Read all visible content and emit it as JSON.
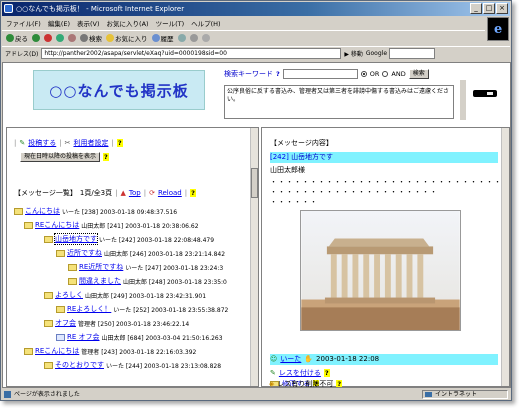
{
  "window": {
    "title": "○○なんでも掲示板！ - Microsoft Internet Explorer",
    "controls": [
      "_",
      "□",
      "×"
    ]
  },
  "menu": [
    "ファイル(F)",
    "編集(E)",
    "表示(V)",
    "お気に入り(A)",
    "ツール(T)",
    "ヘルプ(H)"
  ],
  "toolbar": {
    "back": "戻る",
    "search": "検索",
    "favorites": "お気に入り",
    "history": "履歴"
  },
  "address": {
    "label": "アドレス(D)",
    "url": "http://panther2002/asapa/servlet/eXaq?uid=0000198sid=00",
    "go": "移動",
    "google_label": "Google"
  },
  "board": {
    "title": "○○なんでも掲示板"
  },
  "search": {
    "label": "検索キーワード",
    "or_label": "OR",
    "and_label": "AND",
    "button": "検索"
  },
  "notice": "公序良俗に反する書込み、管理者又は第三者を誹謗中傷する書込みはご遠慮ください。",
  "left": {
    "post_link": "投稿する",
    "terms_link": "利用者設定",
    "recent_button": "現在日時以降の投稿を表示",
    "list_title": "【メッセージ一覧】",
    "page_info": "1頁/全3頁",
    "top_link": "Top",
    "reload_link": "Reload",
    "help": "?",
    "threads": [
      {
        "title": "こんにちは",
        "meta": "いーた [238] 2003-01-18 09:48:37.516"
      },
      {
        "title": "REこんにちは",
        "meta": "山田太郎 [241] 2003-01-18 20:38:06.62"
      },
      {
        "title": "山岳地方です",
        "meta": "いーた [242] 2003-01-18 22:08:48.479"
      },
      {
        "title": "近所ですね",
        "meta": "山田太郎 [246] 2003-01-18 23:21:14.842"
      },
      {
        "title": "RE近所ですね",
        "meta": "いーた [247] 2003-01-18 23:24:3"
      },
      {
        "title": "間違えました",
        "meta": "山田太郎 [248] 2003-01-18 23:35:0"
      },
      {
        "title": "よろしく",
        "meta": "山田太郎 [249] 2003-01-18 23:42:31.901"
      },
      {
        "title": "REよろしく！",
        "meta": "いーた [252] 2003-01-18 23:55:38.872"
      },
      {
        "title": "オフ会",
        "meta": "管理者 [250] 2003-01-18 23:46:22.14"
      },
      {
        "title": "RE オフ会",
        "meta": "山田太郎 [684] 2003-03-04 21:50:16.263"
      },
      {
        "title": "REこんにちは",
        "meta": "管理者 [243] 2003-01-18 22:16:03.392"
      },
      {
        "title": "そのとおりです",
        "meta": "いーた [244] 2003-01-18 23:13:08.828"
      }
    ]
  },
  "right": {
    "heading": "【メッセージ内容】",
    "msg_number": "[242]",
    "msg_title": "山岳地方です",
    "recipient": "山田太郎様",
    "body_lines": [
      "・・・・・・・・・・・・・・・・・・・・・・・・・・・・・・・・・・",
      "・・・・・・・・・・・・・・・・・・・・・",
      "・・・・・・"
    ],
    "author": "いーた",
    "datetime": "2003-01-18 22:08",
    "reply_link": "レスを付ける",
    "edit_link": "修正する",
    "delete_note": "レス有り削除不可"
  },
  "status": {
    "text": "ページが表示されました",
    "zone": "イントラネット"
  },
  "colors": {
    "title_start": "#08246b",
    "banner_bg": "#c9eaf3",
    "banner_text": "#2234c6",
    "highlight": "#80f2ff",
    "link": "#0000ee",
    "help_badge": "#ffff00"
  }
}
